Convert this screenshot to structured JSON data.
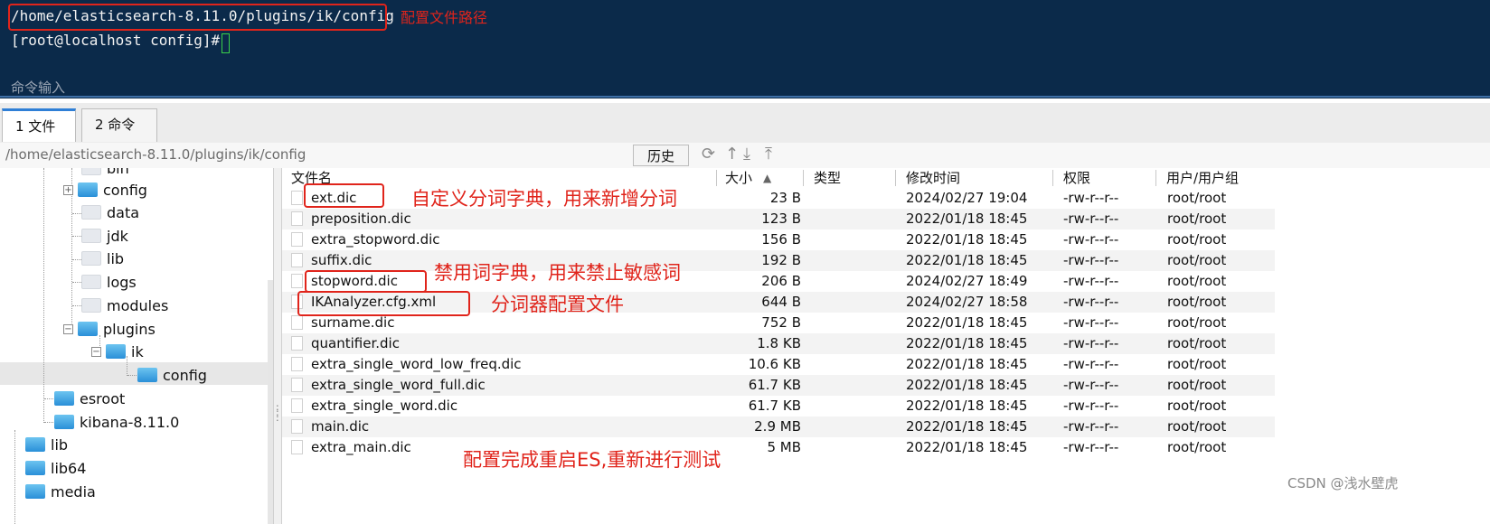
{
  "terminal": {
    "path_line": "/home/elasticsearch-8.11.0/plugins/ik/config",
    "prompt_line": "[root@localhost config]# ",
    "path_annotation": "配置文件路径",
    "command_input_label": "命令输入"
  },
  "tabs": [
    {
      "label": "1 文件"
    },
    {
      "label": "2 命令"
    }
  ],
  "path_bar": {
    "path": "/home/elasticsearch-8.11.0/plugins/ik/config",
    "history_label": "历史"
  },
  "tree": {
    "items": [
      {
        "label": "bin"
      },
      {
        "label": "config"
      },
      {
        "label": "data"
      },
      {
        "label": "jdk"
      },
      {
        "label": "lib"
      },
      {
        "label": "logs"
      },
      {
        "label": "modules"
      },
      {
        "label": "plugins"
      },
      {
        "label": "ik"
      },
      {
        "label": "config"
      },
      {
        "label": "esroot"
      },
      {
        "label": "kibana-8.11.0"
      },
      {
        "label": "lib"
      },
      {
        "label": "lib64"
      },
      {
        "label": "media"
      }
    ]
  },
  "file_list": {
    "columns": {
      "name": "文件名",
      "size": "大小",
      "sort_indicator": "▲",
      "type": "类型",
      "modified": "修改时间",
      "permissions": "权限",
      "owner": "用户/用户组"
    },
    "rows": [
      {
        "name": "ext.dic",
        "size": "23 B",
        "modified": "2024/02/27 19:04",
        "perm": "-rw-r--r--",
        "owner": "root/root"
      },
      {
        "name": "preposition.dic",
        "size": "123 B",
        "modified": "2022/01/18 18:45",
        "perm": "-rw-r--r--",
        "owner": "root/root"
      },
      {
        "name": "extra_stopword.dic",
        "size": "156 B",
        "modified": "2022/01/18 18:45",
        "perm": "-rw-r--r--",
        "owner": "root/root"
      },
      {
        "name": "suffix.dic",
        "size": "192 B",
        "modified": "2022/01/18 18:45",
        "perm": "-rw-r--r--",
        "owner": "root/root"
      },
      {
        "name": "stopword.dic",
        "size": "206 B",
        "modified": "2024/02/27 18:49",
        "perm": "-rw-r--r--",
        "owner": "root/root"
      },
      {
        "name": "IKAnalyzer.cfg.xml",
        "size": "644 B",
        "modified": "2024/02/27 18:58",
        "perm": "-rw-r--r--",
        "owner": "root/root"
      },
      {
        "name": "surname.dic",
        "size": "752 B",
        "modified": "2022/01/18 18:45",
        "perm": "-rw-r--r--",
        "owner": "root/root"
      },
      {
        "name": "quantifier.dic",
        "size": "1.8 KB",
        "modified": "2022/01/18 18:45",
        "perm": "-rw-r--r--",
        "owner": "root/root"
      },
      {
        "name": "extra_single_word_low_freq.dic",
        "size": "10.6 KB",
        "modified": "2022/01/18 18:45",
        "perm": "-rw-r--r--",
        "owner": "root/root"
      },
      {
        "name": "extra_single_word_full.dic",
        "size": "61.7 KB",
        "modified": "2022/01/18 18:45",
        "perm": "-rw-r--r--",
        "owner": "root/root"
      },
      {
        "name": "extra_single_word.dic",
        "size": "61.7 KB",
        "modified": "2022/01/18 18:45",
        "perm": "-rw-r--r--",
        "owner": "root/root"
      },
      {
        "name": "main.dic",
        "size": "2.9 MB",
        "modified": "2022/01/18 18:45",
        "perm": "-rw-r--r--",
        "owner": "root/root"
      },
      {
        "name": "extra_main.dic",
        "size": "5 MB",
        "modified": "2022/01/18 18:45",
        "perm": "-rw-r--r--",
        "owner": "root/root"
      }
    ]
  },
  "annotations": {
    "ext_dic": "自定义分词字典，用来新增分词",
    "stopword_dic": "禁用词字典，用来禁止敏感词",
    "ik_config": "分词器配置文件",
    "restart": "配置完成重启ES,重新进行测试"
  },
  "watermark": "CSDN @浅水壁虎",
  "colors": {
    "terminal_bg": "#0b2a4a",
    "annotation_red": "#e0241b",
    "tab_accent": "#2f7fd6",
    "folder_blue": "#2a8fd8"
  }
}
